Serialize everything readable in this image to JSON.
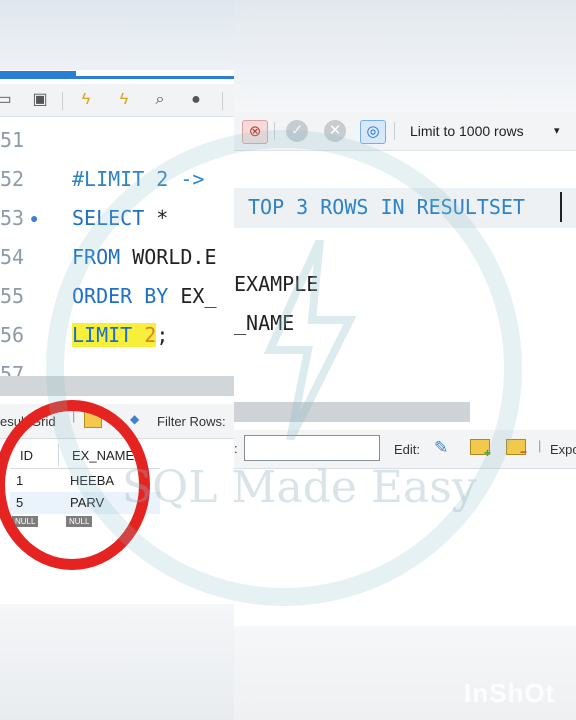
{
  "left_editor": {
    "line_numbers": [
      "51",
      "52",
      "53",
      "54",
      "55",
      "56",
      "57"
    ],
    "comment": "#LIMIT 2 ->",
    "select_kw": "SELECT",
    "select_rest": " *",
    "from_kw": "FROM",
    "from_rest": " WORLD.E",
    "order_kw": "ORDER BY",
    "order_rest": " EX_",
    "limit_kw": "LIMIT",
    "limit_num": "2",
    "limit_end": ";"
  },
  "left_results": {
    "grid_label": "esult Grid",
    "filter_label": "Filter Rows:",
    "columns": [
      "ID",
      "EX_NAME"
    ],
    "rows": [
      [
        "1",
        "HEEBA"
      ],
      [
        "5",
        "PARV"
      ]
    ],
    "null_label": "NULL"
  },
  "right_toolbar": {
    "limit_select": "Limit to 1000 rows"
  },
  "right_editor": {
    "comment": "TOP 3 ROWS IN RESULTSET",
    "line_example": "EXAMPLE",
    "line_name": "_NAME"
  },
  "right_results": {
    "edit_label": "Edit:",
    "export_label": "Expo"
  },
  "watermark": {
    "text": "SQL Made Easy",
    "app_mark": "InShOt"
  },
  "colors": {
    "keyword": "#1d6fc8",
    "highlight": "#f7ef3a",
    "circle": "#e52321",
    "accent": "#2a7fd4"
  }
}
